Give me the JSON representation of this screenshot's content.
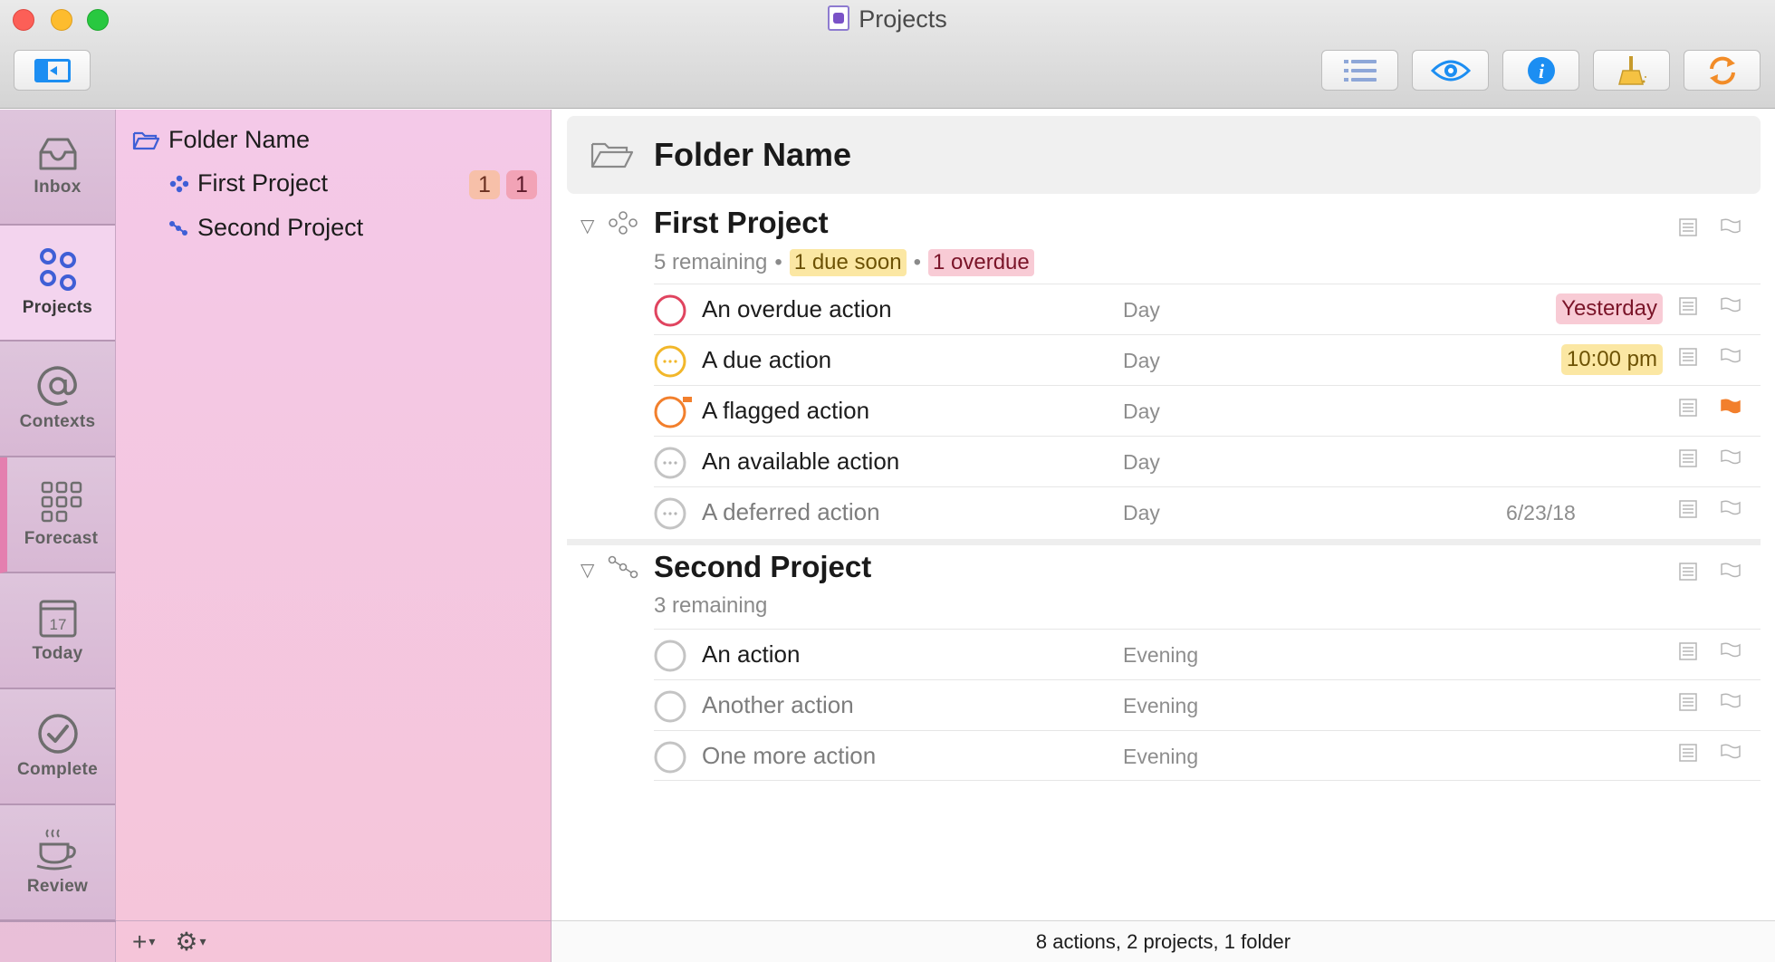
{
  "window": {
    "title": "Projects"
  },
  "toolbar": {
    "sidebar_toggle_icon": "sidebar-toggle-icon",
    "buttons": [
      "list-view-icon",
      "eye-icon",
      "info-icon",
      "clean-up-icon",
      "sync-icon"
    ]
  },
  "perspectives": [
    {
      "label": "Inbox",
      "icon": "inbox-icon"
    },
    {
      "label": "Projects",
      "icon": "projects-icon",
      "active": true
    },
    {
      "label": "Contexts",
      "icon": "at-icon"
    },
    {
      "label": "Forecast",
      "icon": "grid-icon"
    },
    {
      "label": "Today",
      "icon": "calendar-icon",
      "calendar_day": "17"
    },
    {
      "label": "Complete",
      "icon": "checkmark-icon"
    },
    {
      "label": "Review",
      "icon": "coffee-cup-icon"
    }
  ],
  "sidebar": {
    "folder": "Folder Name",
    "projects": [
      {
        "name": "First Project",
        "due_soon_count": "1",
        "overdue_count": "1"
      },
      {
        "name": "Second Project"
      }
    ]
  },
  "main": {
    "folder_title": "Folder Name",
    "projects": [
      {
        "name": "First Project",
        "remaining": "5 remaining",
        "due_soon": "1 due soon",
        "overdue": "1 overdue",
        "actions": [
          {
            "title": "An overdue action",
            "context": "Day",
            "due": "Yesterday",
            "status": "overdue"
          },
          {
            "title": "A due action",
            "context": "Day",
            "due": "10:00 pm",
            "status": "due-soon"
          },
          {
            "title": "A flagged action",
            "context": "Day",
            "status": "flagged",
            "flagged": true
          },
          {
            "title": "An available action",
            "context": "Day",
            "status": "available"
          },
          {
            "title": "A deferred action",
            "context": "Day",
            "defer": "6/23/18",
            "status": "deferred"
          }
        ]
      },
      {
        "name": "Second Project",
        "remaining": "3 remaining",
        "actions": [
          {
            "title": "An action",
            "context": "Evening",
            "status": "available"
          },
          {
            "title": "Another action",
            "context": "Evening",
            "status": "deferred"
          },
          {
            "title": "One more action",
            "context": "Evening",
            "status": "deferred"
          }
        ]
      }
    ]
  },
  "status_bar": "8 actions, 2 projects, 1 folder",
  "colors": {
    "accent_blue": "#1c8ef2",
    "overdue": "#e0445f",
    "due_soon": "#f2b72a",
    "flagged": "#f27f2c",
    "sidebar_pink": "#f4c9e8"
  }
}
